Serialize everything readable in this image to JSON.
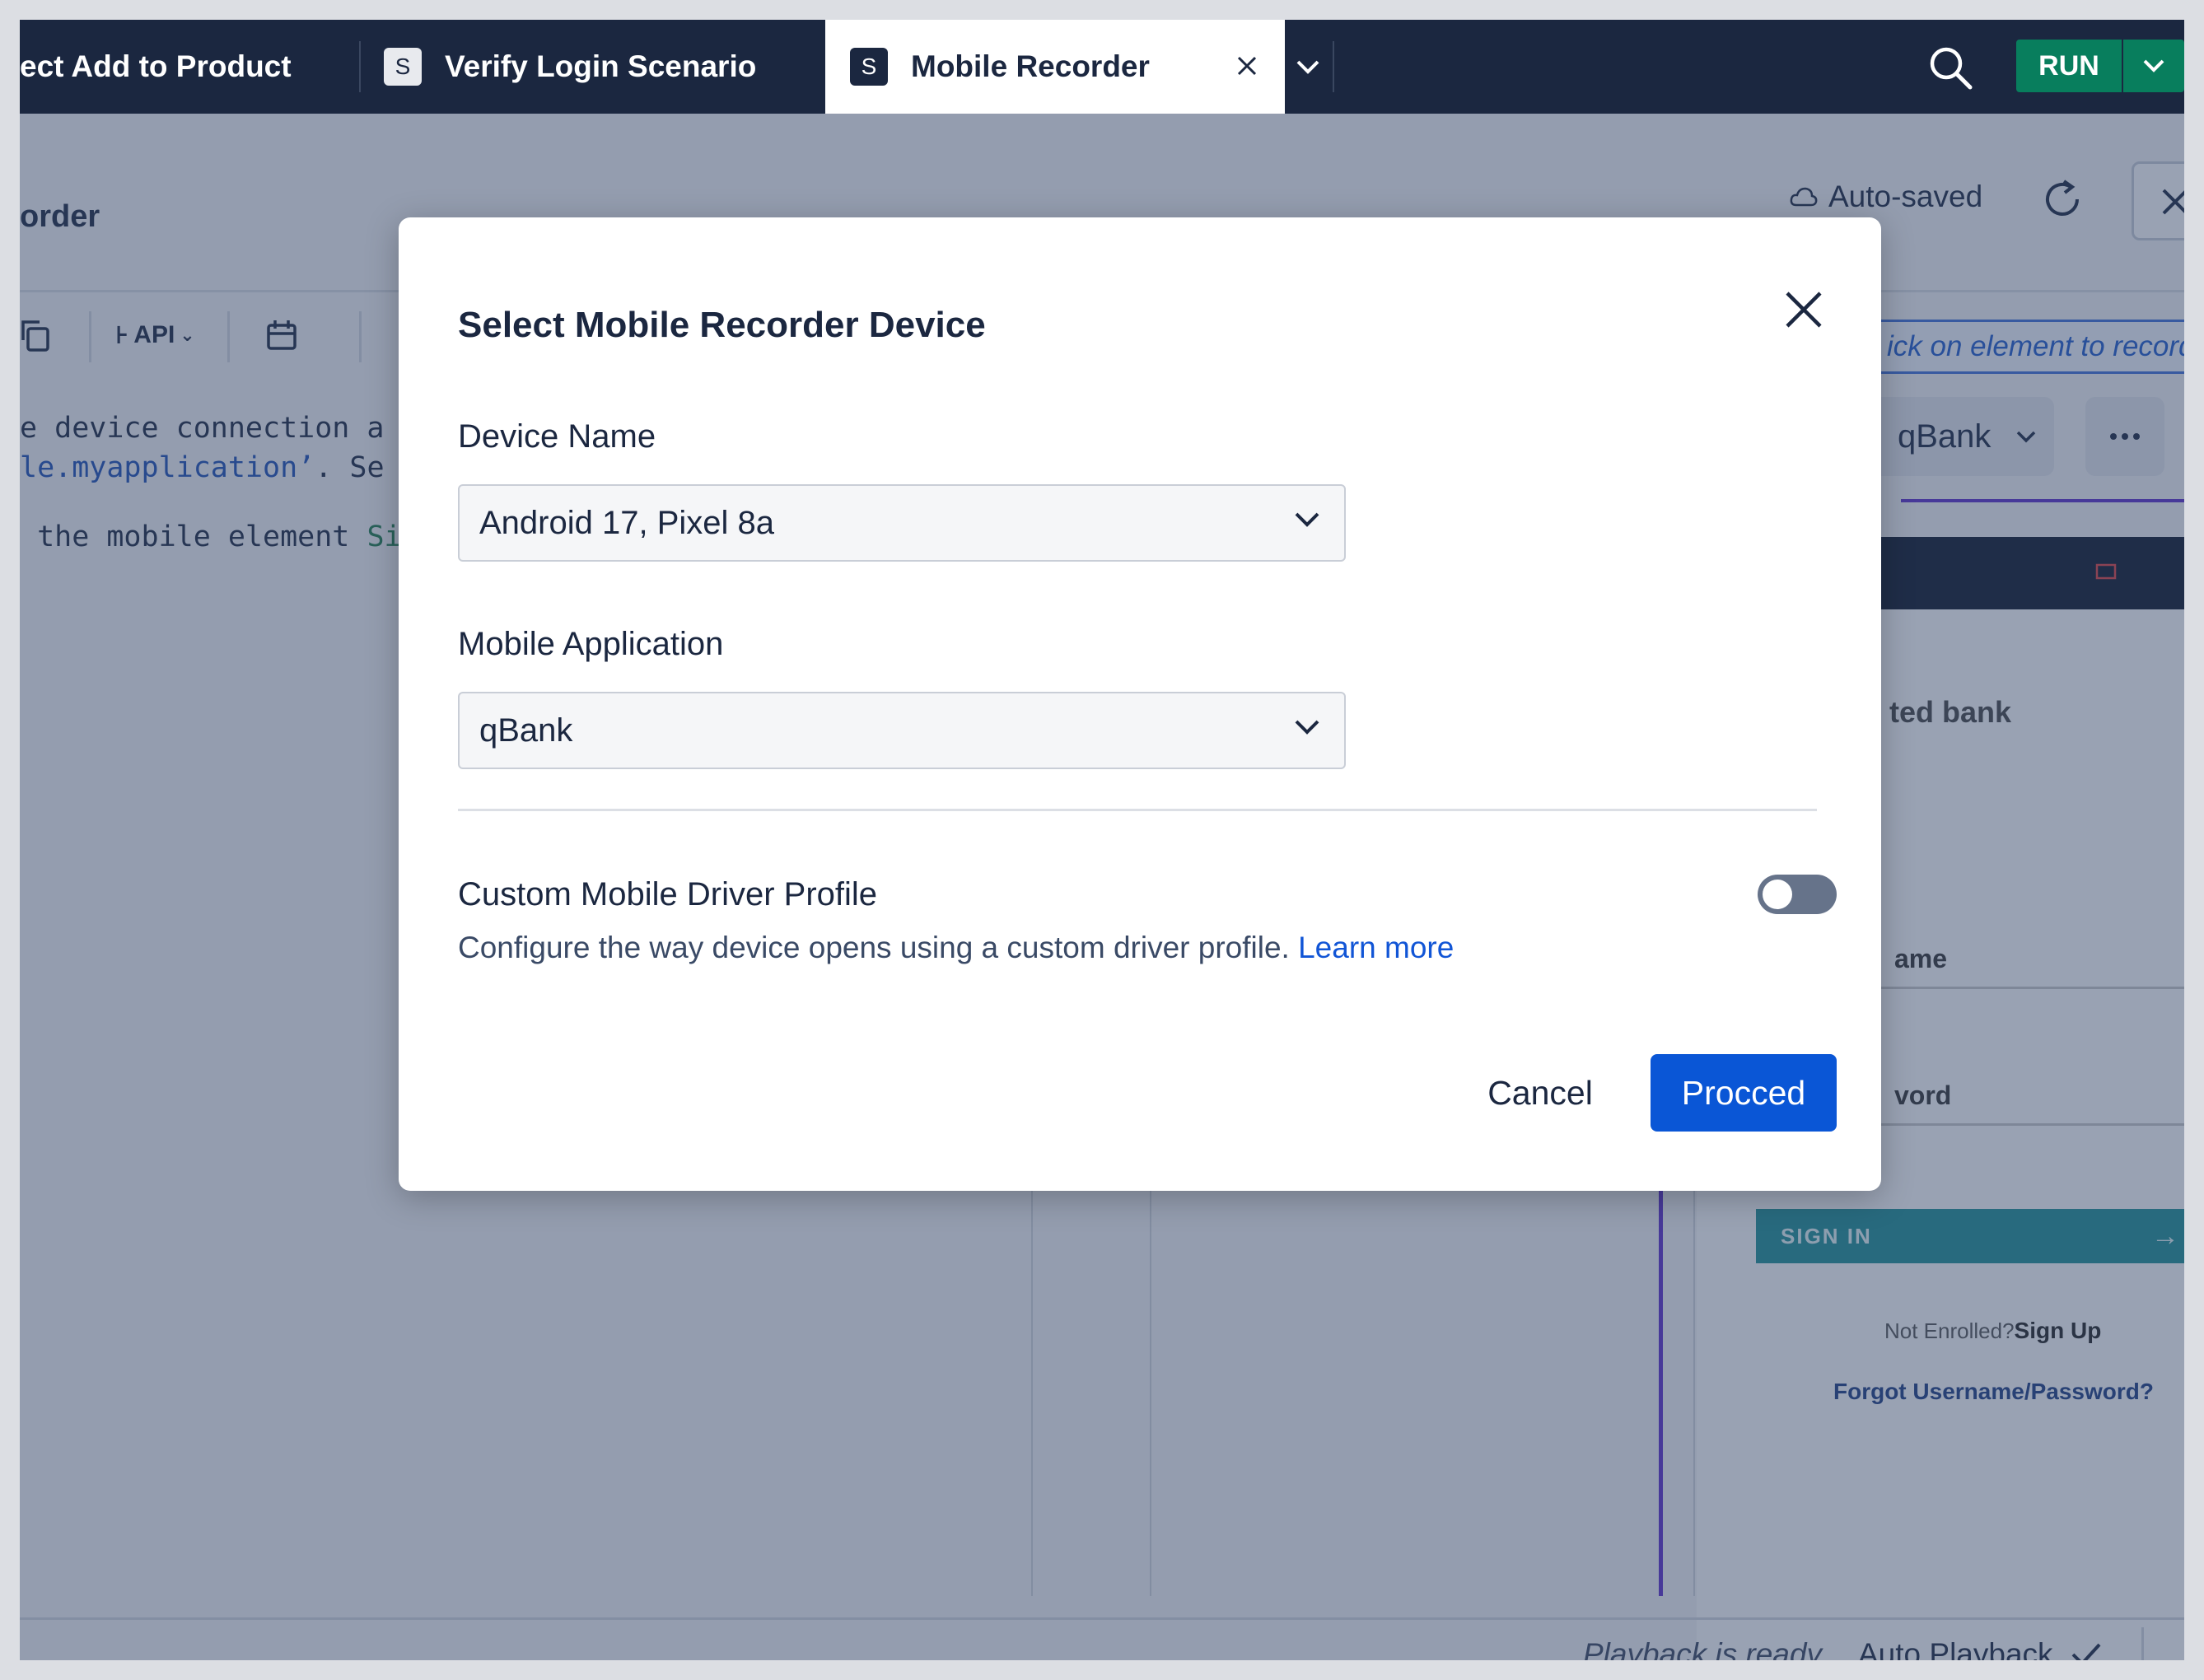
{
  "tabs": [
    {
      "label": "ect Add to Product",
      "badge": ""
    },
    {
      "label": "Verify Login Scenario",
      "badge": "S"
    },
    {
      "label": "Mobile Recorder",
      "badge": "S",
      "active": true
    }
  ],
  "header": {
    "run_label": "RUN"
  },
  "workspace": {
    "title": "order",
    "autosave": "Auto-saved",
    "toolbar_api": "API",
    "code_line1_a": "e device connection a",
    "code_line2_a": "le.myapplication’",
    "code_line2_b": ". Se",
    "code_line3_a": " the mobile element ",
    "code_line3_b": "Si",
    "hint": "ick on element to record",
    "app_select": "qBank"
  },
  "phone": {
    "heading": "ted bank",
    "username_label": "ame",
    "password_label": "vord",
    "signin_label": "SIGN IN",
    "not_enrolled": "Not Enrolled?",
    "sign_up": "Sign Up",
    "forgot": "Forgot Username/Password?"
  },
  "footer": {
    "playback_status": "Playback is ready",
    "auto_playback": "Auto Playback"
  },
  "modal": {
    "title": "Select Mobile Recorder Device",
    "device_label": "Device Name",
    "device_value": "Android 17, Pixel 8a",
    "app_label": "Mobile Application",
    "app_value": "qBank",
    "custom_label": "Custom Mobile Driver Profile",
    "custom_desc": "Configure the way device opens using a custom driver profile.",
    "learn_more": "Learn more",
    "cancel_label": "Cancel",
    "proceed_label": "Procced"
  },
  "colors": {
    "header_bg": "#1b2740",
    "run_green": "#087e5d",
    "primary_blue": "#0a56d6",
    "link_blue": "#1155d6"
  }
}
